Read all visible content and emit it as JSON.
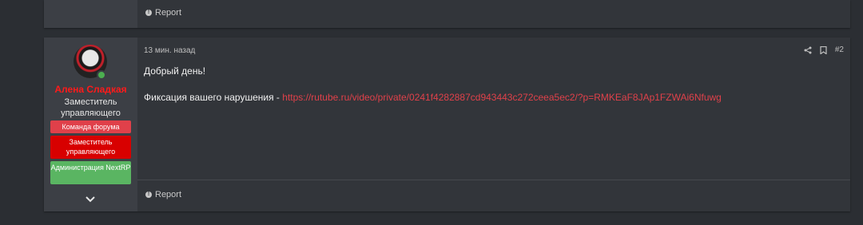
{
  "top_post": {
    "report_label": "Report"
  },
  "post": {
    "author": {
      "name": "Алена Сладкая",
      "title": "Заместитель управляющего",
      "badges": [
        {
          "label": "Команда форума",
          "color": "#e0404a"
        },
        {
          "label": "Заместитель управляющего",
          "color": "#d80000"
        },
        {
          "label": "Администрация NextRP",
          "color": "#5ab562"
        }
      ]
    },
    "time": "13 мин. назад",
    "number": "#2",
    "greeting": "Добрый день!",
    "violation_prefix": "Фиксация вашего нарушения - ",
    "violation_link": "https://rutube.ru/video/private/0241f4282887cd943443c272ceea5ec2/?p=RMKEaF8JAp1FZWAi6Nfuwg",
    "report_label": "Report"
  },
  "colors": {
    "username": "#ff1a1a",
    "link": "#e0414a",
    "background": "#2b2e33"
  }
}
